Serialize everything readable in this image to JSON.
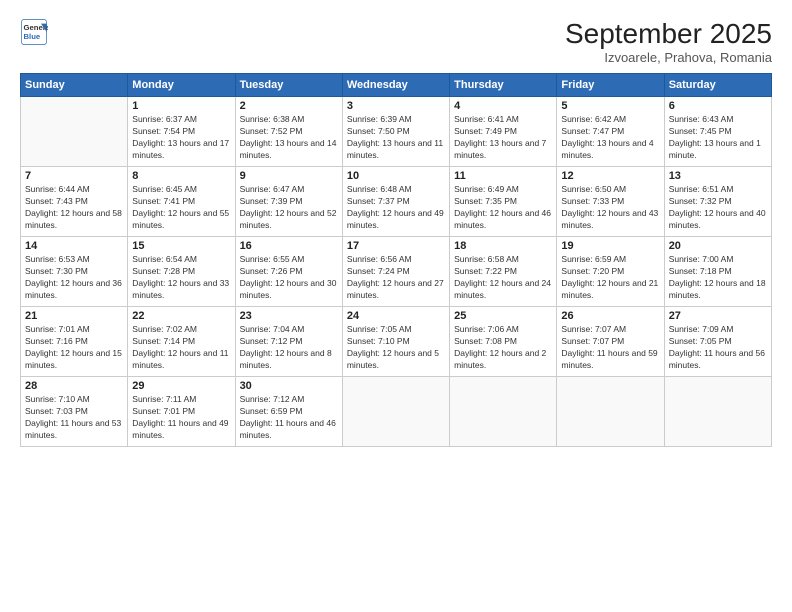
{
  "logo": {
    "line1": "General",
    "line2": "Blue"
  },
  "title": "September 2025",
  "subtitle": "Izvoarele, Prahova, Romania",
  "weekdays": [
    "Sunday",
    "Monday",
    "Tuesday",
    "Wednesday",
    "Thursday",
    "Friday",
    "Saturday"
  ],
  "weeks": [
    [
      {
        "day": "",
        "sunrise": "",
        "sunset": "",
        "daylight": ""
      },
      {
        "day": "1",
        "sunrise": "Sunrise: 6:37 AM",
        "sunset": "Sunset: 7:54 PM",
        "daylight": "Daylight: 13 hours and 17 minutes."
      },
      {
        "day": "2",
        "sunrise": "Sunrise: 6:38 AM",
        "sunset": "Sunset: 7:52 PM",
        "daylight": "Daylight: 13 hours and 14 minutes."
      },
      {
        "day": "3",
        "sunrise": "Sunrise: 6:39 AM",
        "sunset": "Sunset: 7:50 PM",
        "daylight": "Daylight: 13 hours and 11 minutes."
      },
      {
        "day": "4",
        "sunrise": "Sunrise: 6:41 AM",
        "sunset": "Sunset: 7:49 PM",
        "daylight": "Daylight: 13 hours and 7 minutes."
      },
      {
        "day": "5",
        "sunrise": "Sunrise: 6:42 AM",
        "sunset": "Sunset: 7:47 PM",
        "daylight": "Daylight: 13 hours and 4 minutes."
      },
      {
        "day": "6",
        "sunrise": "Sunrise: 6:43 AM",
        "sunset": "Sunset: 7:45 PM",
        "daylight": "Daylight: 13 hours and 1 minute."
      }
    ],
    [
      {
        "day": "7",
        "sunrise": "Sunrise: 6:44 AM",
        "sunset": "Sunset: 7:43 PM",
        "daylight": "Daylight: 12 hours and 58 minutes."
      },
      {
        "day": "8",
        "sunrise": "Sunrise: 6:45 AM",
        "sunset": "Sunset: 7:41 PM",
        "daylight": "Daylight: 12 hours and 55 minutes."
      },
      {
        "day": "9",
        "sunrise": "Sunrise: 6:47 AM",
        "sunset": "Sunset: 7:39 PM",
        "daylight": "Daylight: 12 hours and 52 minutes."
      },
      {
        "day": "10",
        "sunrise": "Sunrise: 6:48 AM",
        "sunset": "Sunset: 7:37 PM",
        "daylight": "Daylight: 12 hours and 49 minutes."
      },
      {
        "day": "11",
        "sunrise": "Sunrise: 6:49 AM",
        "sunset": "Sunset: 7:35 PM",
        "daylight": "Daylight: 12 hours and 46 minutes."
      },
      {
        "day": "12",
        "sunrise": "Sunrise: 6:50 AM",
        "sunset": "Sunset: 7:33 PM",
        "daylight": "Daylight: 12 hours and 43 minutes."
      },
      {
        "day": "13",
        "sunrise": "Sunrise: 6:51 AM",
        "sunset": "Sunset: 7:32 PM",
        "daylight": "Daylight: 12 hours and 40 minutes."
      }
    ],
    [
      {
        "day": "14",
        "sunrise": "Sunrise: 6:53 AM",
        "sunset": "Sunset: 7:30 PM",
        "daylight": "Daylight: 12 hours and 36 minutes."
      },
      {
        "day": "15",
        "sunrise": "Sunrise: 6:54 AM",
        "sunset": "Sunset: 7:28 PM",
        "daylight": "Daylight: 12 hours and 33 minutes."
      },
      {
        "day": "16",
        "sunrise": "Sunrise: 6:55 AM",
        "sunset": "Sunset: 7:26 PM",
        "daylight": "Daylight: 12 hours and 30 minutes."
      },
      {
        "day": "17",
        "sunrise": "Sunrise: 6:56 AM",
        "sunset": "Sunset: 7:24 PM",
        "daylight": "Daylight: 12 hours and 27 minutes."
      },
      {
        "day": "18",
        "sunrise": "Sunrise: 6:58 AM",
        "sunset": "Sunset: 7:22 PM",
        "daylight": "Daylight: 12 hours and 24 minutes."
      },
      {
        "day": "19",
        "sunrise": "Sunrise: 6:59 AM",
        "sunset": "Sunset: 7:20 PM",
        "daylight": "Daylight: 12 hours and 21 minutes."
      },
      {
        "day": "20",
        "sunrise": "Sunrise: 7:00 AM",
        "sunset": "Sunset: 7:18 PM",
        "daylight": "Daylight: 12 hours and 18 minutes."
      }
    ],
    [
      {
        "day": "21",
        "sunrise": "Sunrise: 7:01 AM",
        "sunset": "Sunset: 7:16 PM",
        "daylight": "Daylight: 12 hours and 15 minutes."
      },
      {
        "day": "22",
        "sunrise": "Sunrise: 7:02 AM",
        "sunset": "Sunset: 7:14 PM",
        "daylight": "Daylight: 12 hours and 11 minutes."
      },
      {
        "day": "23",
        "sunrise": "Sunrise: 7:04 AM",
        "sunset": "Sunset: 7:12 PM",
        "daylight": "Daylight: 12 hours and 8 minutes."
      },
      {
        "day": "24",
        "sunrise": "Sunrise: 7:05 AM",
        "sunset": "Sunset: 7:10 PM",
        "daylight": "Daylight: 12 hours and 5 minutes."
      },
      {
        "day": "25",
        "sunrise": "Sunrise: 7:06 AM",
        "sunset": "Sunset: 7:08 PM",
        "daylight": "Daylight: 12 hours and 2 minutes."
      },
      {
        "day": "26",
        "sunrise": "Sunrise: 7:07 AM",
        "sunset": "Sunset: 7:07 PM",
        "daylight": "Daylight: 11 hours and 59 minutes."
      },
      {
        "day": "27",
        "sunrise": "Sunrise: 7:09 AM",
        "sunset": "Sunset: 7:05 PM",
        "daylight": "Daylight: 11 hours and 56 minutes."
      }
    ],
    [
      {
        "day": "28",
        "sunrise": "Sunrise: 7:10 AM",
        "sunset": "Sunset: 7:03 PM",
        "daylight": "Daylight: 11 hours and 53 minutes."
      },
      {
        "day": "29",
        "sunrise": "Sunrise: 7:11 AM",
        "sunset": "Sunset: 7:01 PM",
        "daylight": "Daylight: 11 hours and 49 minutes."
      },
      {
        "day": "30",
        "sunrise": "Sunrise: 7:12 AM",
        "sunset": "Sunset: 6:59 PM",
        "daylight": "Daylight: 11 hours and 46 minutes."
      },
      {
        "day": "",
        "sunrise": "",
        "sunset": "",
        "daylight": ""
      },
      {
        "day": "",
        "sunrise": "",
        "sunset": "",
        "daylight": ""
      },
      {
        "day": "",
        "sunrise": "",
        "sunset": "",
        "daylight": ""
      },
      {
        "day": "",
        "sunrise": "",
        "sunset": "",
        "daylight": ""
      }
    ]
  ]
}
